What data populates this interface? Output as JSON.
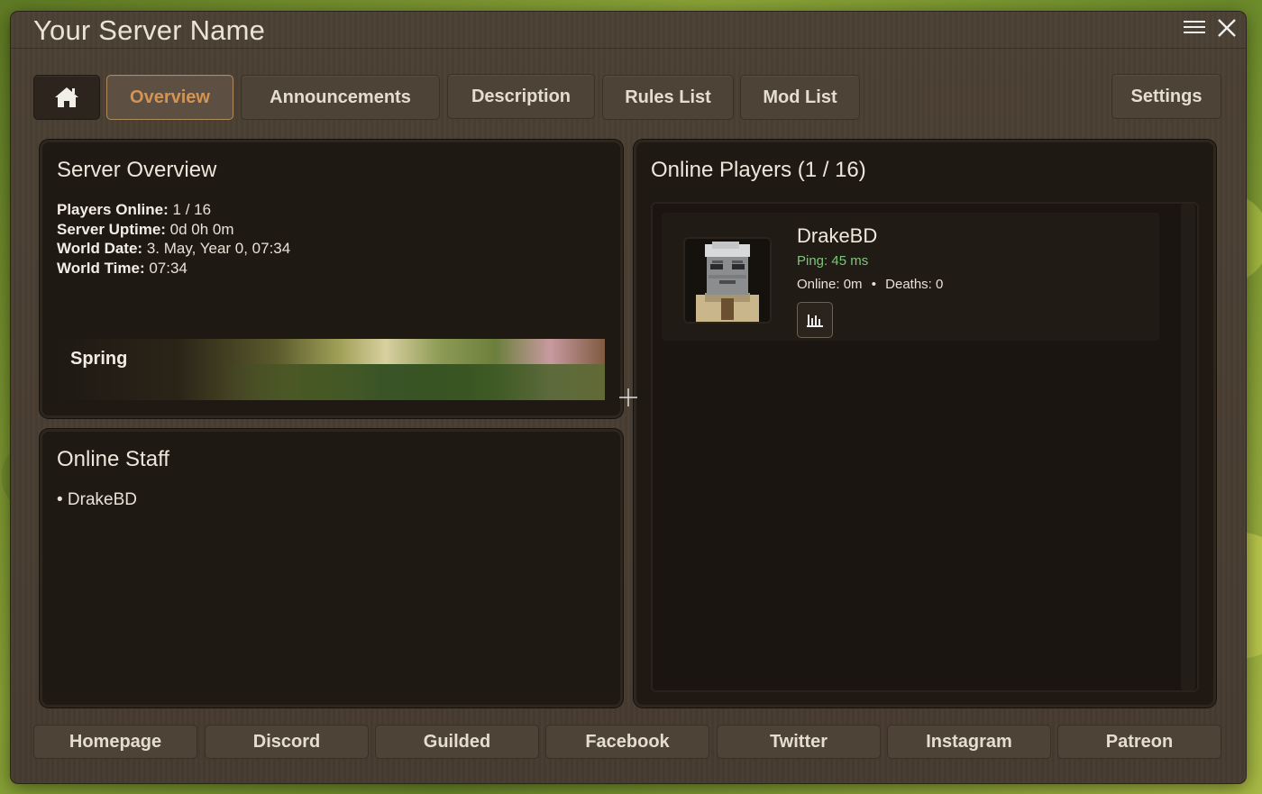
{
  "window": {
    "title": "Your Server Name"
  },
  "tabs": [
    {
      "label": "Overview",
      "active": true
    },
    {
      "label": "Announcements"
    },
    {
      "label": "Description"
    },
    {
      "label": "Rules List"
    },
    {
      "label": "Mod List"
    }
  ],
  "settings_label": "Settings",
  "overview": {
    "title": "Server Overview",
    "stats": [
      {
        "label": "Players Online:",
        "value": "1 / 16"
      },
      {
        "label": "Server Uptime:",
        "value": "0d 0h 0m"
      },
      {
        "label": "World Date:",
        "value": "3. May, Year 0, 07:34"
      },
      {
        "label": "World Time:",
        "value": "07:34"
      }
    ],
    "season": "Spring"
  },
  "staff": {
    "title": "Online Staff",
    "members": [
      "• DrakeBD"
    ]
  },
  "players": {
    "title": "Online Players (1 / 16)",
    "list": [
      {
        "name": "DrakeBD",
        "ping": "Ping: 45 ms",
        "online": "Online: 0m",
        "separator": "•",
        "deaths": "Deaths: 0"
      }
    ]
  },
  "footer": [
    "Homepage",
    "Discord",
    "Guilded",
    "Facebook",
    "Twitter",
    "Instagram",
    "Patreon"
  ],
  "colors": {
    "accent": "#d39454",
    "ping": "#7cc77a",
    "panel": "#1e1913",
    "frame": "#4a3f33"
  }
}
